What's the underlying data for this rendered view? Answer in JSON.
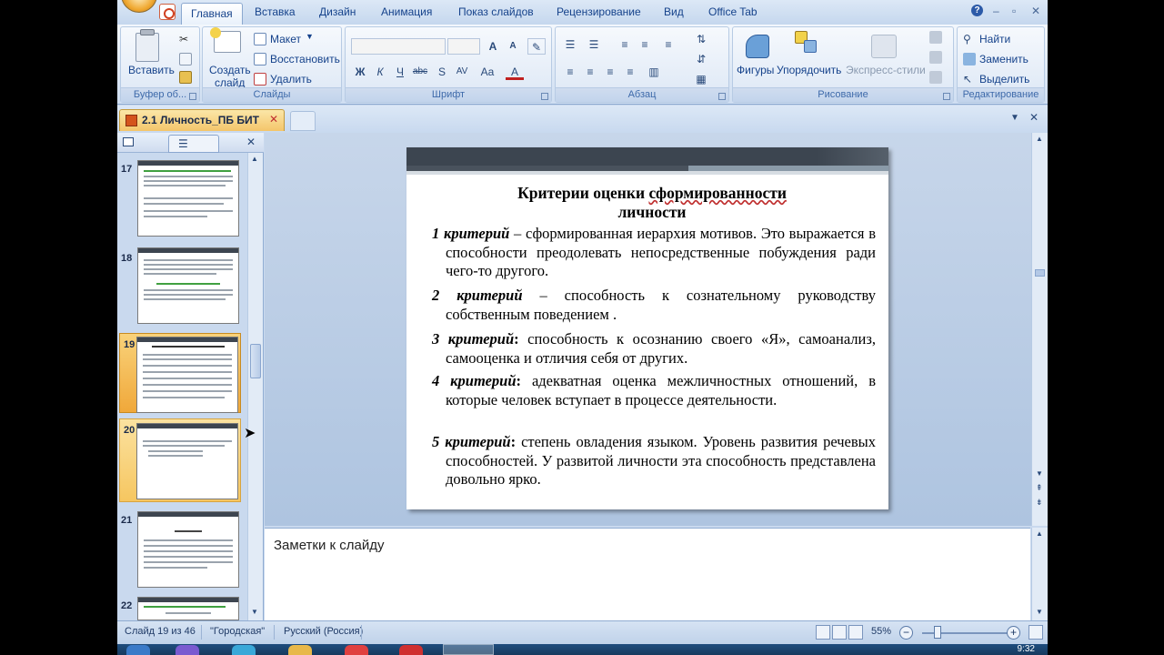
{
  "ribbon_tabs": [
    {
      "label": "Главная",
      "active": true
    },
    {
      "label": "Вставка"
    },
    {
      "label": "Дизайн"
    },
    {
      "label": "Анимация"
    },
    {
      "label": "Показ слайдов"
    },
    {
      "label": "Рецензирование"
    },
    {
      "label": "Вид"
    },
    {
      "label": "Office Tab"
    }
  ],
  "ribbon": {
    "clipboard": {
      "paste": "Вставить",
      "group": "Буфер об..."
    },
    "slides": {
      "new_slide_1": "Создать",
      "new_slide_2": "слайд",
      "layout": "Макет",
      "reset": "Восстановить",
      "delete": "Удалить",
      "group": "Слайды"
    },
    "font": {
      "bold": "Ж",
      "italic": "К",
      "underline": "Ч",
      "strike": "abc",
      "shadow": "S",
      "spacing": "AV",
      "case": "Aa",
      "color": "A",
      "grow": "A",
      "shrink": "A",
      "group": "Шрифт"
    },
    "paragraph": {
      "group": "Абзац"
    },
    "drawing": {
      "shapes": "Фигуры",
      "arrange": "Упорядочить",
      "quick_styles": "Экспресс-стили",
      "group": "Рисование"
    },
    "editing": {
      "find": "Найти",
      "replace": "Заменить",
      "select": "Выделить",
      "group": "Редактирование"
    }
  },
  "document_tab": {
    "title": "2.1 Личность_ПБ БИТ"
  },
  "thumbnails": [
    {
      "number": "17"
    },
    {
      "number": "18"
    },
    {
      "number": "19",
      "selected": true
    },
    {
      "number": "20",
      "hover": true
    },
    {
      "number": "21"
    },
    {
      "number": "22"
    }
  ],
  "slide": {
    "title_part1": "Критерии оценки ",
    "title_part2": "сформированности",
    "title_part3": "личности",
    "criteria": [
      {
        "label": "1 критерий",
        "sep": " – ",
        "text": "сформированная иерархия мотивов. Это выражается в способности преодолевать непосредственные побуждения ради чего-то другого."
      },
      {
        "label": "2 критерий",
        "sep": " – ",
        "text": "способность к сознательному руководству собственным поведением ."
      },
      {
        "label": "3 критерий",
        "sep": ": ",
        "text": "способность к осознанию своего «Я», самоанализ, самооценка и отличия себя от других."
      },
      {
        "label": "4 критерий",
        "sep": ": ",
        "text": "адекватная оценка межличностных отношений, в которые человек вступает в процессе деятельности."
      },
      {
        "label": "5 критерий",
        "sep": ": ",
        "text": "степень овладения языком. Уровень развития речевых способностей. У развитой личности эта способность представлена довольно ярко."
      }
    ]
  },
  "notes": {
    "placeholder": "Заметки к слайду"
  },
  "status_bar": {
    "slide_position": "Слайд 19 из 46",
    "theme": "\"Городская\"",
    "language": "Русский (Россия)",
    "zoom": "55%"
  },
  "taskbar": {
    "time": "9:32"
  },
  "colors": {
    "accent": "#15428b",
    "selected_thumb": "#f0a83a",
    "slide_band": "#3c4550"
  }
}
